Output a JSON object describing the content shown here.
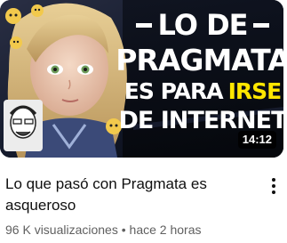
{
  "video": {
    "thumbnail": {
      "headline_line1": "LO DE",
      "headline_line2": "PRAGMATA",
      "headline_line3_white": "ES PARA",
      "headline_line3_yellow": "IRSE",
      "headline_line4": "DE INTERNET",
      "duration": "14:12",
      "accent_color": "#ffe600",
      "text_color": "#ffffff"
    },
    "title": "Lo que pasó con Pragmata es asqueroso",
    "views": "96 K visualizaciones",
    "separator": "•",
    "age": "hace 2 horas",
    "menu_icon": "more-vert-icon"
  }
}
